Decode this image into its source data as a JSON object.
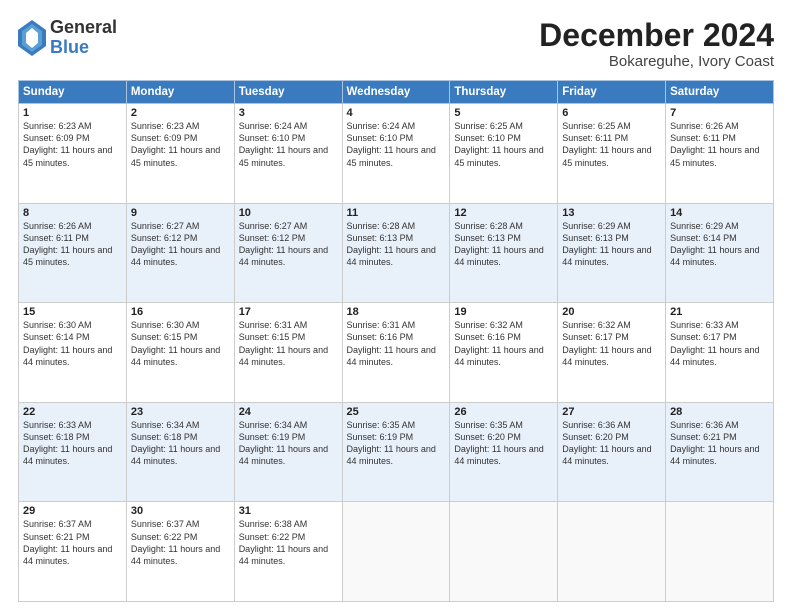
{
  "header": {
    "logo_general": "General",
    "logo_blue": "Blue",
    "month_title": "December 2024",
    "subtitle": "Bokareguhe, Ivory Coast"
  },
  "weekdays": [
    "Sunday",
    "Monday",
    "Tuesday",
    "Wednesday",
    "Thursday",
    "Friday",
    "Saturday"
  ],
  "weeks": [
    [
      {
        "day": 1,
        "sunrise": "6:23 AM",
        "sunset": "6:09 PM",
        "daylight": "11 hours and 45 minutes."
      },
      {
        "day": 2,
        "sunrise": "6:23 AM",
        "sunset": "6:09 PM",
        "daylight": "11 hours and 45 minutes."
      },
      {
        "day": 3,
        "sunrise": "6:24 AM",
        "sunset": "6:10 PM",
        "daylight": "11 hours and 45 minutes."
      },
      {
        "day": 4,
        "sunrise": "6:24 AM",
        "sunset": "6:10 PM",
        "daylight": "11 hours and 45 minutes."
      },
      {
        "day": 5,
        "sunrise": "6:25 AM",
        "sunset": "6:10 PM",
        "daylight": "11 hours and 45 minutes."
      },
      {
        "day": 6,
        "sunrise": "6:25 AM",
        "sunset": "6:11 PM",
        "daylight": "11 hours and 45 minutes."
      },
      {
        "day": 7,
        "sunrise": "6:26 AM",
        "sunset": "6:11 PM",
        "daylight": "11 hours and 45 minutes."
      }
    ],
    [
      {
        "day": 8,
        "sunrise": "6:26 AM",
        "sunset": "6:11 PM",
        "daylight": "11 hours and 45 minutes."
      },
      {
        "day": 9,
        "sunrise": "6:27 AM",
        "sunset": "6:12 PM",
        "daylight": "11 hours and 44 minutes."
      },
      {
        "day": 10,
        "sunrise": "6:27 AM",
        "sunset": "6:12 PM",
        "daylight": "11 hours and 44 minutes."
      },
      {
        "day": 11,
        "sunrise": "6:28 AM",
        "sunset": "6:13 PM",
        "daylight": "11 hours and 44 minutes."
      },
      {
        "day": 12,
        "sunrise": "6:28 AM",
        "sunset": "6:13 PM",
        "daylight": "11 hours and 44 minutes."
      },
      {
        "day": 13,
        "sunrise": "6:29 AM",
        "sunset": "6:13 PM",
        "daylight": "11 hours and 44 minutes."
      },
      {
        "day": 14,
        "sunrise": "6:29 AM",
        "sunset": "6:14 PM",
        "daylight": "11 hours and 44 minutes."
      }
    ],
    [
      {
        "day": 15,
        "sunrise": "6:30 AM",
        "sunset": "6:14 PM",
        "daylight": "11 hours and 44 minutes."
      },
      {
        "day": 16,
        "sunrise": "6:30 AM",
        "sunset": "6:15 PM",
        "daylight": "11 hours and 44 minutes."
      },
      {
        "day": 17,
        "sunrise": "6:31 AM",
        "sunset": "6:15 PM",
        "daylight": "11 hours and 44 minutes."
      },
      {
        "day": 18,
        "sunrise": "6:31 AM",
        "sunset": "6:16 PM",
        "daylight": "11 hours and 44 minutes."
      },
      {
        "day": 19,
        "sunrise": "6:32 AM",
        "sunset": "6:16 PM",
        "daylight": "11 hours and 44 minutes."
      },
      {
        "day": 20,
        "sunrise": "6:32 AM",
        "sunset": "6:17 PM",
        "daylight": "11 hours and 44 minutes."
      },
      {
        "day": 21,
        "sunrise": "6:33 AM",
        "sunset": "6:17 PM",
        "daylight": "11 hours and 44 minutes."
      }
    ],
    [
      {
        "day": 22,
        "sunrise": "6:33 AM",
        "sunset": "6:18 PM",
        "daylight": "11 hours and 44 minutes."
      },
      {
        "day": 23,
        "sunrise": "6:34 AM",
        "sunset": "6:18 PM",
        "daylight": "11 hours and 44 minutes."
      },
      {
        "day": 24,
        "sunrise": "6:34 AM",
        "sunset": "6:19 PM",
        "daylight": "11 hours and 44 minutes."
      },
      {
        "day": 25,
        "sunrise": "6:35 AM",
        "sunset": "6:19 PM",
        "daylight": "11 hours and 44 minutes."
      },
      {
        "day": 26,
        "sunrise": "6:35 AM",
        "sunset": "6:20 PM",
        "daylight": "11 hours and 44 minutes."
      },
      {
        "day": 27,
        "sunrise": "6:36 AM",
        "sunset": "6:20 PM",
        "daylight": "11 hours and 44 minutes."
      },
      {
        "day": 28,
        "sunrise": "6:36 AM",
        "sunset": "6:21 PM",
        "daylight": "11 hours and 44 minutes."
      }
    ],
    [
      {
        "day": 29,
        "sunrise": "6:37 AM",
        "sunset": "6:21 PM",
        "daylight": "11 hours and 44 minutes."
      },
      {
        "day": 30,
        "sunrise": "6:37 AM",
        "sunset": "6:22 PM",
        "daylight": "11 hours and 44 minutes."
      },
      {
        "day": 31,
        "sunrise": "6:38 AM",
        "sunset": "6:22 PM",
        "daylight": "11 hours and 44 minutes."
      },
      null,
      null,
      null,
      null
    ]
  ]
}
